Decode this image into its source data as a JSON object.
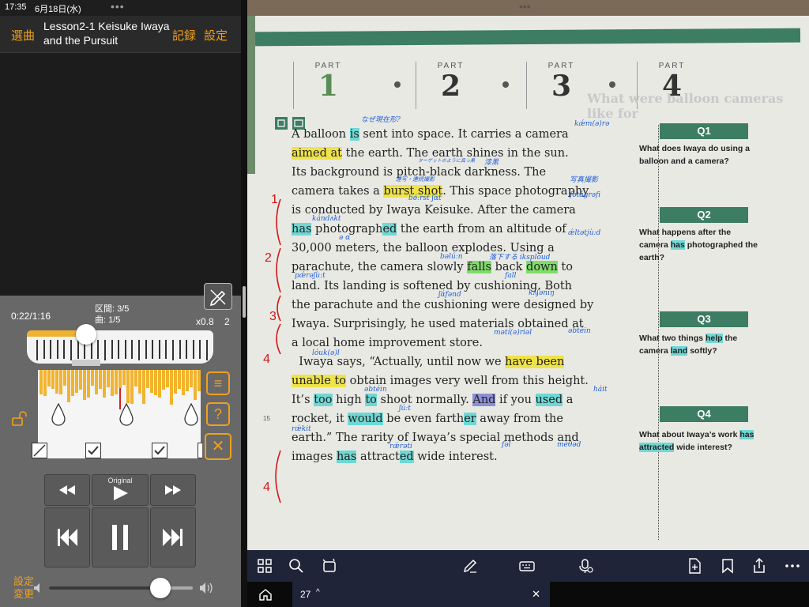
{
  "status_bar": {
    "time": "17:35",
    "date": "6月18日(水)"
  },
  "left_header": {
    "select_label": "選曲",
    "title": "Lesson2-1 Keisuke Iwaya and the Pursuit",
    "record_label": "記録",
    "settings_label": "設定"
  },
  "player": {
    "elapsed": "0:22/1:16",
    "section": "区間: 3/5",
    "track": "曲: 1/5",
    "speed": "x0.8",
    "speed_extra": "2",
    "original_label": "Original",
    "progress_fraction": 0.29,
    "settings_change": "設定\n変更",
    "volume_fraction": 0.78,
    "checkboxes": [
      false,
      true,
      true,
      false
    ]
  },
  "textbook": {
    "parts": [
      {
        "label": "PART",
        "num": "1",
        "active": true
      },
      {
        "label": "PART",
        "num": "2",
        "active": false
      },
      {
        "label": "PART",
        "num": "3",
        "active": false
      },
      {
        "label": "PART",
        "num": "4",
        "active": false
      }
    ],
    "bg_title": "What were balloon cameras like for",
    "line_margin_number": "15",
    "annotations_blue": [
      "なぜ現在形?",
      "kǽm(ə)rə",
      "ターゲットのように真っ黒",
      "漆黒",
      "連写・連続撮影",
      "写真撮影",
      "fətágrəfi",
      "bə́ːrst ʃɑ́t",
      "kándʌkt",
      "ə ɑ",
      "ǽltətjùːd",
      "bəlúːn",
      "落下する iksplóud",
      "fall",
      "pǽrəʃùːt",
      "ʃɑ́fənd",
      "kʌ́ʃəniŋ",
      "lóuk(ə)l",
      "mətí(ə)riəl",
      "əbtéin",
      "əbtéin",
      "ʃúːt",
      "háit",
      "rǽkit",
      "fəl",
      "méθəd",
      "rǽrəti"
    ],
    "q1": {
      "label": "Q1",
      "text": "What does Iwaya do using a balloon and a camera?"
    },
    "q2": {
      "label": "Q2",
      "text_pre": "What happens after the camera ",
      "text_hl": "has",
      "text_post": " photographed the earth?"
    },
    "q3": {
      "label": "Q3",
      "text_pre": "What two things ",
      "text_hl": "help",
      "text_mid": " the camera ",
      "text_hl2": "land",
      "text_post": " softly?"
    },
    "q4": {
      "label": "Q4",
      "text_pre": "What about Iwaya’s work ",
      "text_hl": "has attracted",
      "text_post": " wide interest?"
    }
  },
  "tab": {
    "page_number": "27"
  }
}
